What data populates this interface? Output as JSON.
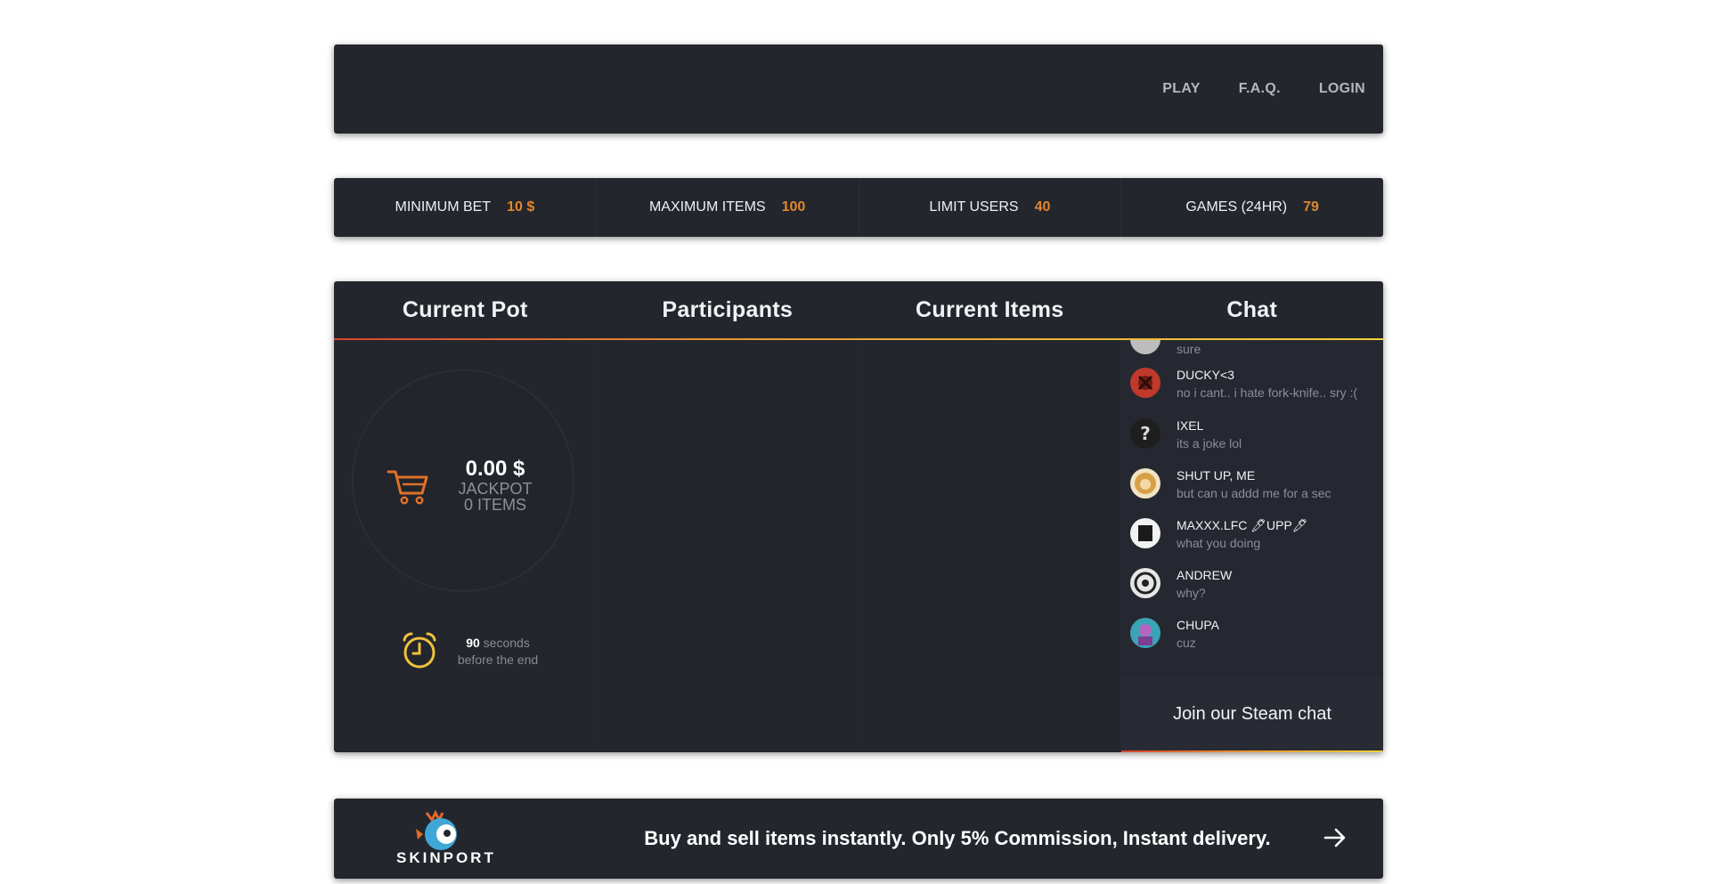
{
  "nav": {
    "links": [
      {
        "label": "PLAY"
      },
      {
        "label": "F.A.Q."
      },
      {
        "label": "LOGIN"
      }
    ]
  },
  "stats": [
    {
      "label": "MINIMUM BET",
      "value": "10 $"
    },
    {
      "label": "MAXIMUM ITEMS",
      "value": "100"
    },
    {
      "label": "LIMIT USERS",
      "value": "40"
    },
    {
      "label": "GAMES (24HR)",
      "value": "79"
    }
  ],
  "main": {
    "headers": [
      "Current Pot",
      "Participants",
      "Current Items",
      "Chat"
    ],
    "pot": {
      "amount": "0.00 $",
      "label": "JACKPOT",
      "items": "0 ITEMS",
      "cart_icon": "cart-icon",
      "timer_seconds": "90",
      "timer_unit": "seconds",
      "timer_suffix": "before the end",
      "clock_icon": "alarm-clock-icon"
    },
    "chat": {
      "messages": [
        {
          "user": "",
          "text": "sure",
          "avatar_color": "#bdbdbd"
        },
        {
          "user": "DUCKY<3",
          "text": "no i cant.. i hate fork-knife.. sry :(",
          "avatar_color": "#c0392b"
        },
        {
          "user": "IXEL",
          "text": "its a joke lol",
          "avatar_color": "#1e1e1e"
        },
        {
          "user": "SHUT UP, ME",
          "text": "but can u addd me for a sec",
          "avatar_color": "#d8a046"
        },
        {
          "user": "MAXXX.LFC 🖊UPP🖊",
          "text": "what you doing",
          "avatar_color": "#f2f2f2"
        },
        {
          "user": "ANDREW",
          "text": "why?",
          "avatar_color": "#e6e6e6"
        },
        {
          "user": "CHUPA",
          "text": "cuz",
          "avatar_color": "#3aa3b5"
        }
      ],
      "join_label": "Join our Steam chat"
    }
  },
  "banner": {
    "brand": "SKINPORT",
    "text": "Buy and sell items instantly. Only 5% Commission, Instant delivery.",
    "arrow_icon": "arrow-right-icon"
  },
  "colors": {
    "panel": "#23262d",
    "accent_orange": "#e0872d",
    "accent_yellow": "#f0d23a",
    "accent_red": "#d9432f"
  }
}
